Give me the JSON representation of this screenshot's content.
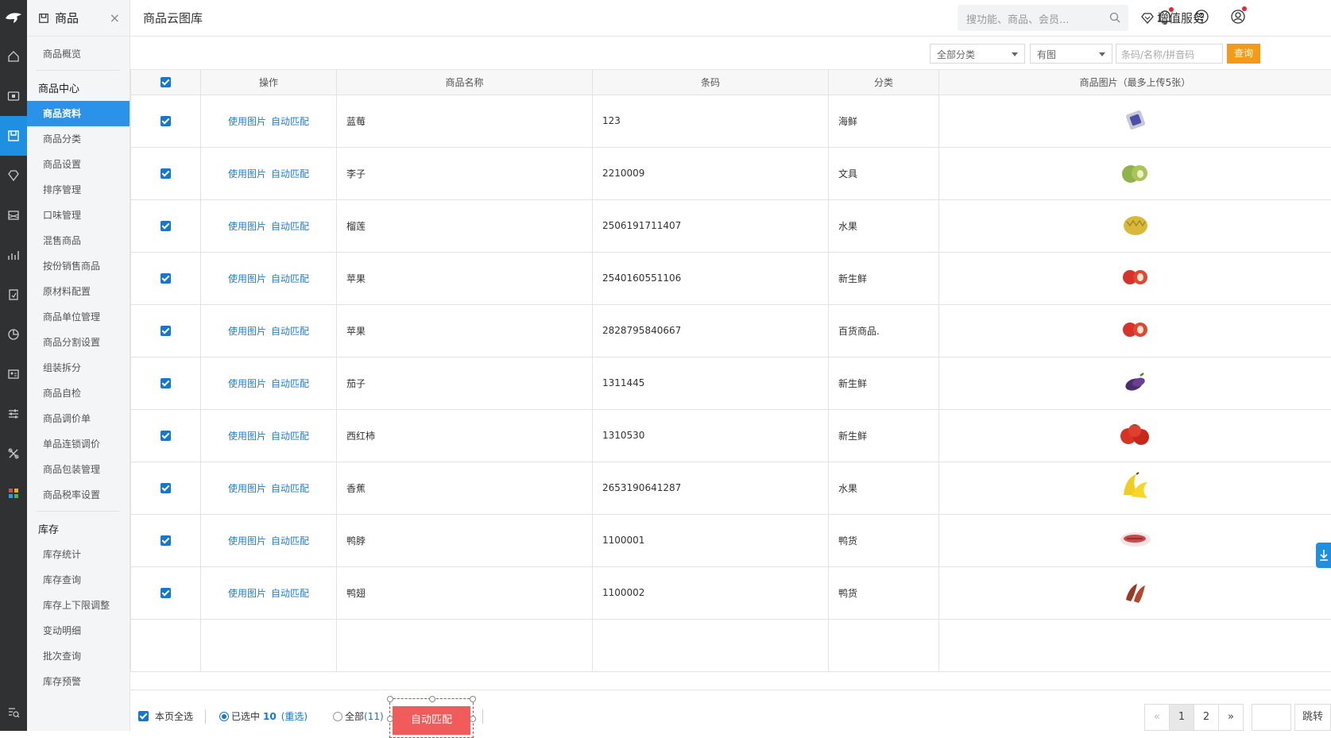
{
  "topbar": {
    "title": "商品云图库",
    "search_placeholder": "搜功能、商品、会员...",
    "vas": "增值服务"
  },
  "subnav": {
    "header": "商品",
    "close": "×",
    "overview": "商品概览",
    "group1": "商品中心",
    "items1": [
      "商品资料",
      "商品分类",
      "商品设置",
      "排序管理",
      "口味管理",
      "混售商品",
      "按份销售商品",
      "原材料配置",
      "商品单位管理",
      "商品分割设置",
      "组装拆分",
      "商品自检",
      "商品调价单",
      "单品连锁调价",
      "商品包装管理",
      "商品税率设置"
    ],
    "group2": "库存",
    "items2": [
      "库存统计",
      "库存查询",
      "库存上下限调整",
      "变动明细",
      "批次查询",
      "库存预警"
    ]
  },
  "filter": {
    "category": "全部分类",
    "has_image": "有图",
    "input_placeholder": "条码/名称/拼音码",
    "query": "查询"
  },
  "table": {
    "headers": [
      "操作",
      "商品名称",
      "条码",
      "分类",
      "商品图片（最多上传5张）"
    ],
    "use_image": "使用图片",
    "auto_match": "自动匹配",
    "rows": [
      {
        "name": "蓝莓",
        "code": "123",
        "cat": "海鲜",
        "img": "packaged-item"
      },
      {
        "name": "李子",
        "code": "2210009",
        "cat": "文具",
        "img": "plum"
      },
      {
        "name": "榴莲",
        "code": "2506191711407",
        "cat": "水果",
        "img": "durian"
      },
      {
        "name": "苹果",
        "code": "2540160551106",
        "cat": "新生鲜",
        "img": "apple"
      },
      {
        "name": "苹果",
        "code": "2828795840667",
        "cat": "百货商品.",
        "img": "apple"
      },
      {
        "name": "茄子",
        "code": "1311445",
        "cat": "新生鲜",
        "img": "eggplant"
      },
      {
        "name": "西红柿",
        "code": "1310530",
        "cat": "新生鲜",
        "img": "tomato"
      },
      {
        "name": "香蕉",
        "code": "2653190641287",
        "cat": "水果",
        "img": "banana"
      },
      {
        "name": "鸭脖",
        "code": "1100001",
        "cat": "鸭货",
        "img": "duck-meat"
      },
      {
        "name": "鸭翅",
        "code": "1100002",
        "cat": "鸭货",
        "img": "duck-wings"
      }
    ]
  },
  "footer": {
    "select_page": "本页全选",
    "selected_prefix": "已选中",
    "selected_count": "10",
    "reselect": "(重选)",
    "all_label": "全部",
    "all_count": "(11)",
    "auto_match_btn": "自动匹配",
    "pages": [
      "«",
      "1",
      "2",
      "»"
    ],
    "jump": "跳转"
  }
}
